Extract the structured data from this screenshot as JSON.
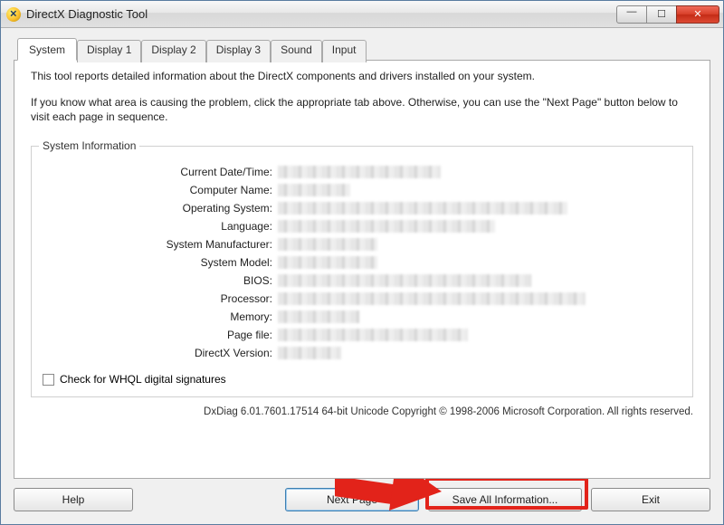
{
  "window": {
    "title": "DirectX Diagnostic Tool"
  },
  "tabs": [
    {
      "label": "System",
      "active": true
    },
    {
      "label": "Display 1",
      "active": false
    },
    {
      "label": "Display 2",
      "active": false
    },
    {
      "label": "Display 3",
      "active": false
    },
    {
      "label": "Sound",
      "active": false
    },
    {
      "label": "Input",
      "active": false
    }
  ],
  "intro": {
    "line1": "This tool reports detailed information about the DirectX components and drivers installed on your system.",
    "line2": "If you know what area is causing the problem, click the appropriate tab above.  Otherwise, you can use the \"Next Page\" button below to visit each page in sequence."
  },
  "group": {
    "title": "System Information",
    "rows": [
      {
        "label": "Current Date/Time:"
      },
      {
        "label": "Computer Name:"
      },
      {
        "label": "Operating System:"
      },
      {
        "label": "Language:"
      },
      {
        "label": "System Manufacturer:"
      },
      {
        "label": "System Model:"
      },
      {
        "label": "BIOS:"
      },
      {
        "label": "Processor:"
      },
      {
        "label": "Memory:"
      },
      {
        "label": "Page file:"
      },
      {
        "label": "DirectX Version:"
      }
    ],
    "checkbox_label": "Check for WHQL digital signatures"
  },
  "copyright": "DxDiag 6.01.7601.17514 64-bit Unicode  Copyright © 1998-2006 Microsoft Corporation.  All rights reserved.",
  "buttons": {
    "help": "Help",
    "next": "Next Page",
    "save": "Save All Information...",
    "exit": "Exit"
  },
  "annotation": {
    "arrow_color": "#e2231a",
    "highlight_target": "save-all-information-button"
  }
}
